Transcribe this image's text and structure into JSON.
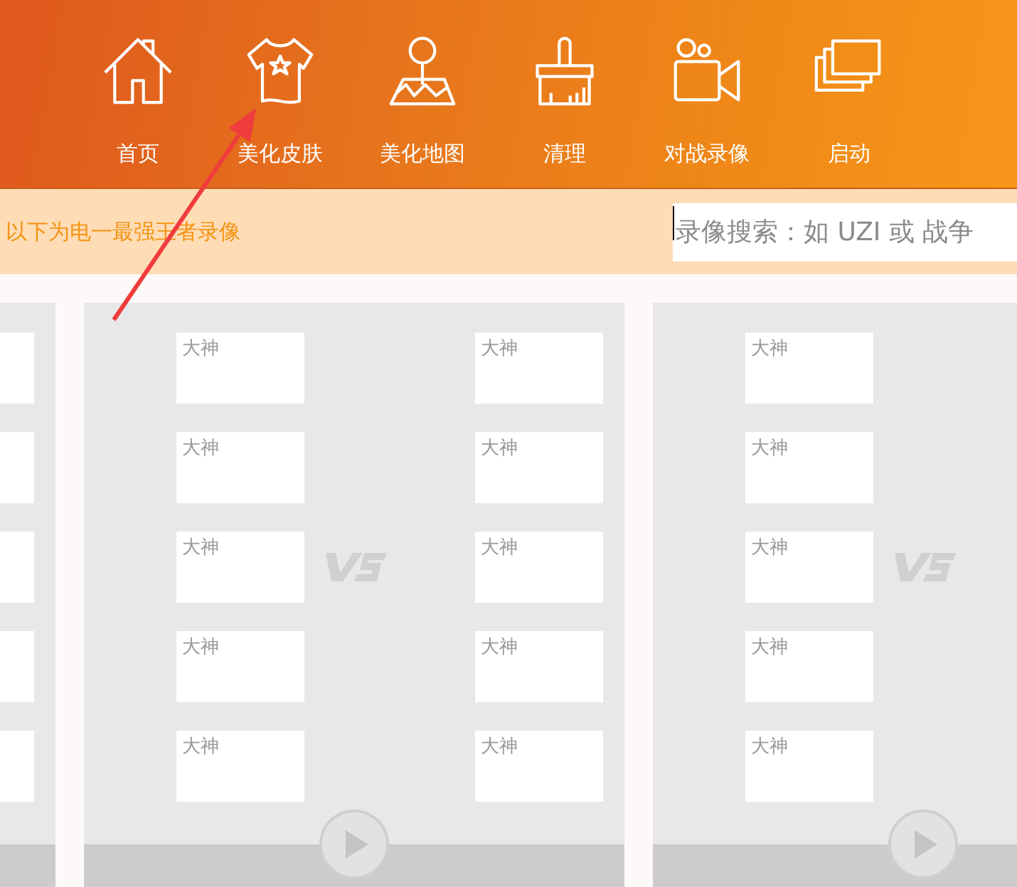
{
  "nav": [
    {
      "kind": "home",
      "label": "首页"
    },
    {
      "kind": "shirt",
      "label": "美化皮肤"
    },
    {
      "kind": "map",
      "label": "美化地图"
    },
    {
      "kind": "brush",
      "label": "清理"
    },
    {
      "kind": "camera",
      "label": "对战录像"
    },
    {
      "kind": "windows",
      "label": "启动"
    }
  ],
  "banner": {
    "text": "以下为电一最强王者录像",
    "search": {
      "placeholder": "录像搜索：如 UZI 或 战争"
    }
  },
  "cards": [
    {
      "kind": "edge",
      "right": [
        {
          "kind": "slot"
        },
        {
          "kind": "slot"
        },
        {
          "kind": "slot"
        },
        {
          "kind": "slot"
        },
        {
          "kind": "slot"
        }
      ]
    },
    {
      "kind": "match",
      "left": [
        {
          "kind": "slot",
          "label": "大神"
        },
        {
          "kind": "slot",
          "label": "大神"
        },
        {
          "kind": "slot",
          "label": "大神"
        },
        {
          "kind": "slot",
          "label": "大神"
        },
        {
          "kind": "slot",
          "label": "大神"
        }
      ],
      "right": [
        {
          "kind": "slot",
          "label": "大神"
        },
        {
          "kind": "slot",
          "label": "大神"
        },
        {
          "kind": "slot",
          "label": "大神"
        },
        {
          "kind": "slot",
          "label": "大神"
        },
        {
          "kind": "slot",
          "label": "大神"
        }
      ]
    },
    {
      "kind": "match",
      "left": [
        {
          "kind": "slot",
          "label": "大神"
        },
        {
          "kind": "slot",
          "label": "大神"
        },
        {
          "kind": "slot",
          "label": "大神"
        },
        {
          "kind": "slot",
          "label": "大神"
        },
        {
          "kind": "slot",
          "label": "大神"
        }
      ]
    }
  ]
}
